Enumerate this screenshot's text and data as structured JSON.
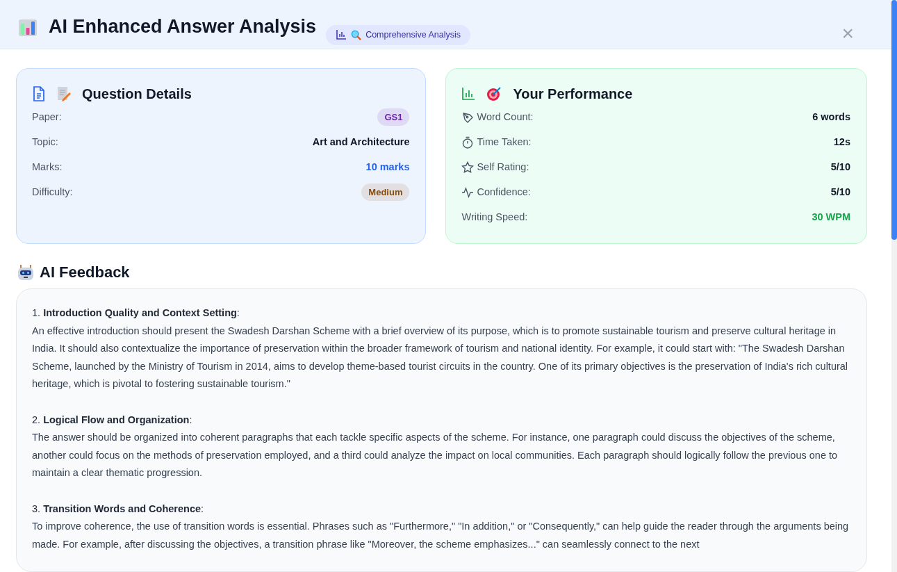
{
  "header": {
    "title": "AI Enhanced Answer Analysis",
    "badge": "Comprehensive Analysis",
    "close": "×"
  },
  "question_details": {
    "title": "Question Details",
    "rows": [
      {
        "label": "Paper:",
        "value": "GS1",
        "kind": "badge",
        "color": "#6b21a8"
      },
      {
        "label": "Topic:",
        "value": "Art and Architecture",
        "kind": "text"
      },
      {
        "label": "Marks:",
        "value": "10 marks",
        "kind": "accent",
        "color": "#2563eb"
      },
      {
        "label": "Difficulty:",
        "value": "Medium",
        "kind": "badge",
        "color": "#854d0e"
      }
    ]
  },
  "performance": {
    "title": "Your Performance",
    "rows": [
      {
        "label": "Word Count:",
        "value": "6 words",
        "kind": "text"
      },
      {
        "label": "Time Taken:",
        "value": "12s",
        "kind": "text"
      },
      {
        "label": "Self Rating:",
        "value": "5/10",
        "kind": "text"
      },
      {
        "label": "Confidence:",
        "value": "5/10",
        "kind": "text"
      },
      {
        "label": "Writing Speed:",
        "value": "30 WPM",
        "kind": "accent",
        "color": "#16a34a"
      }
    ]
  },
  "feedback": {
    "title": "AI Feedback",
    "items": [
      {
        "heading": "1. **Introduction Quality and Context Setting**:",
        "body": "An effective introduction should present the Swadesh Darshan Scheme with a brief overview of its purpose, which is to promote sustainable tourism and preserve cultural heritage in India. It should also contextualize the importance of preservation within the broader framework of tourism and national identity. For example, it could start with: \"The Swadesh Darshan Scheme, launched by the Ministry of Tourism in 2014, aims to develop theme-based tourist circuits in the country. One of its primary objectives is the preservation of India's rich cultural heritage, which is pivotal to fostering sustainable tourism.\""
      },
      {
        "heading": "2. **Logical Flow and Organization**:",
        "body": "The answer should be organized into coherent paragraphs that each tackle specific aspects of the scheme. For instance, one paragraph could discuss the objectives of the scheme, another could focus on the methods of preservation employed, and a third could analyze the impact on local communities. Each paragraph should logically follow the previous one to maintain a clear thematic progression."
      },
      {
        "heading": "3. **Transition Words and Coherence**:",
        "body": "To improve coherence, the use of transition words is essential. Phrases such as \"Furthermore,\" \"In addition,\" or \"Consequently,\" can help guide the reader through the arguments being made. For example, after discussing the objectives, a transition phrase like \"Moreover, the scheme emphasizes...\" can seamlessly connect to the next"
      }
    ]
  }
}
